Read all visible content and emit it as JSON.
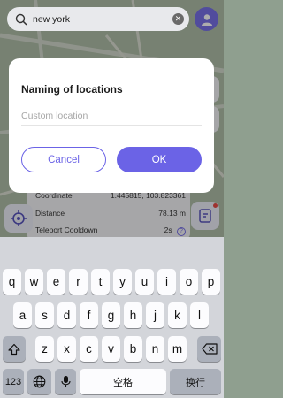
{
  "search": {
    "query": "new york",
    "search_icon": "search-icon",
    "clear_icon": "clear-icon"
  },
  "avatar_icon": "user-icon",
  "info": {
    "coordinate_label": "Coordinate",
    "coordinate_value": "1.445815, 103.823361",
    "distance_label": "Distance",
    "distance_value": "78.13 m",
    "cooldown_label": "Teleport Cooldown",
    "cooldown_value": "2s"
  },
  "dialog": {
    "title": "Naming of locations",
    "placeholder": "Custom location",
    "cancel_label": "Cancel",
    "ok_label": "OK"
  },
  "keyboard": {
    "row1": [
      "q",
      "w",
      "e",
      "r",
      "t",
      "y",
      "u",
      "i",
      "o",
      "p"
    ],
    "row2": [
      "a",
      "s",
      "d",
      "f",
      "g",
      "h",
      "j",
      "k",
      "l"
    ],
    "row3": [
      "z",
      "x",
      "c",
      "v",
      "b",
      "n",
      "m"
    ],
    "num_label": "123",
    "space_label": "空格",
    "return_label": "换行"
  },
  "colors": {
    "accent": "#6b63e6",
    "map_green": "#a8b8a0",
    "keyboard_bg": "#d3d5da"
  }
}
